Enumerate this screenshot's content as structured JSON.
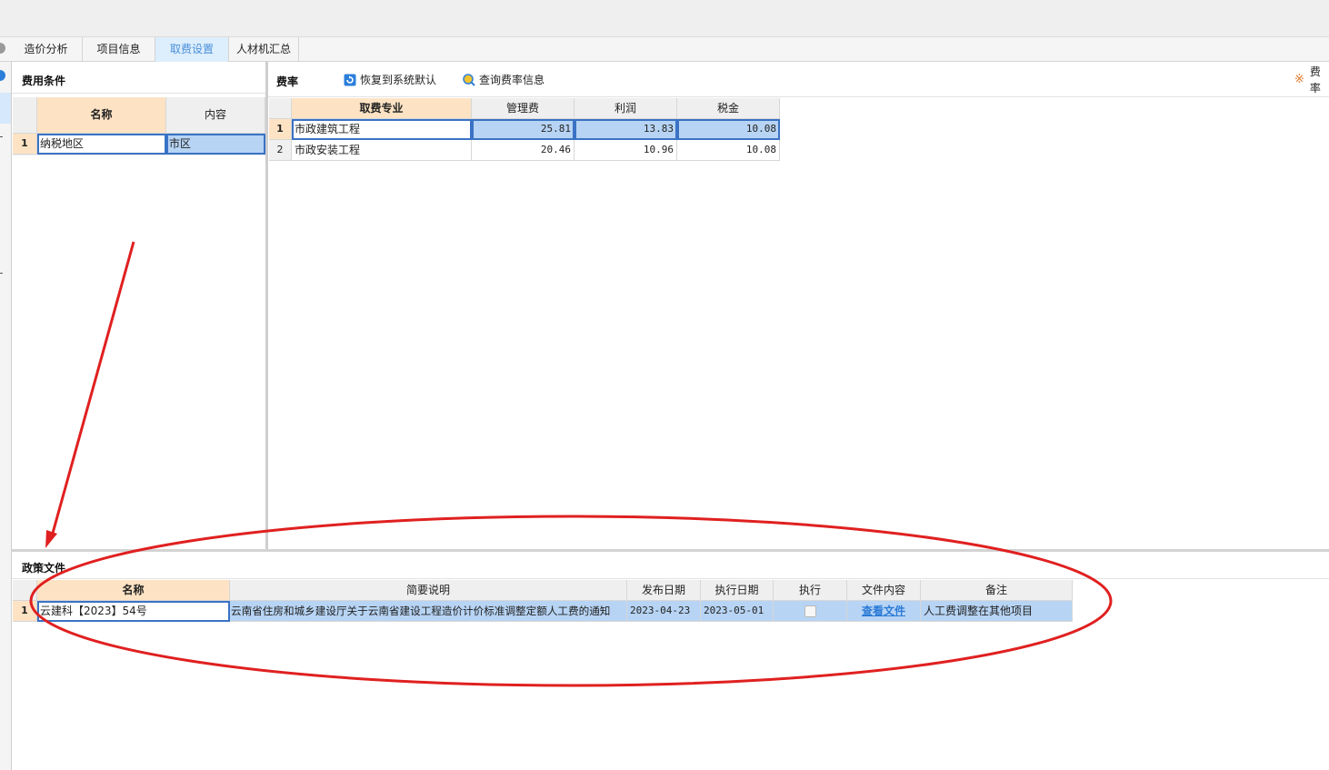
{
  "tabs": [
    {
      "label": "造价分析",
      "active": false
    },
    {
      "label": "项目信息",
      "active": false
    },
    {
      "label": "取费设置",
      "active": true
    },
    {
      "label": "人材机汇总",
      "active": false
    }
  ],
  "fee_conditions": {
    "title": "费用条件",
    "headers": {
      "name": "名称",
      "content": "内容"
    },
    "rows": [
      {
        "num": "1",
        "name": "纳税地区",
        "content": "市区"
      }
    ]
  },
  "rates": {
    "title": "费率",
    "restore_label": "恢复到系统默认",
    "query_label": "查询费率信息",
    "right_label": "费率",
    "headers": {
      "specialty": "取费专业",
      "mgmt": "管理费",
      "profit": "利润",
      "tax": "税金"
    },
    "rows": [
      {
        "num": "1",
        "specialty": "市政建筑工程",
        "mgmt": "25.81",
        "profit": "13.83",
        "tax": "10.08"
      },
      {
        "num": "2",
        "specialty": "市政安装工程",
        "mgmt": "20.46",
        "profit": "10.96",
        "tax": "10.08"
      }
    ]
  },
  "policy": {
    "title": "政策文件",
    "headers": {
      "name": "名称",
      "desc": "简要说明",
      "publish": "发布日期",
      "exec_date": "执行日期",
      "execute": "执行",
      "content": "文件内容",
      "remark": "备注"
    },
    "rows": [
      {
        "num": "1",
        "name": "云建科【2023】54号",
        "desc": "云南省住房和城乡建设厅关于云南省建设工程造价计价标准调整定额人工费的通知",
        "publish": "2023-04-23",
        "exec_date": "2023-05-01",
        "executed": false,
        "content": "查看文件",
        "remark": "人工费调整在其他项目"
      }
    ]
  },
  "colors": {
    "accent": "#4a90d9",
    "header_orange": "#fde3c4",
    "selection": "#b7d4f4",
    "annotation": "#e02020"
  }
}
